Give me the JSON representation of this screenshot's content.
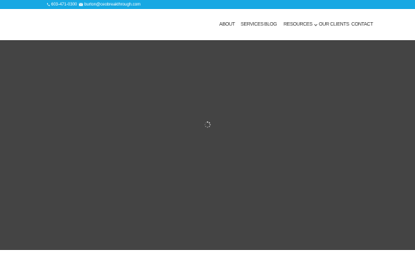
{
  "topbar": {
    "phone": "603-471-0300",
    "email": "burton@ceobreakthrough.com",
    "phone_icon": "phone-icon",
    "email_icon": "envelope-icon",
    "background_color": "#17a8e3"
  },
  "nav": {
    "items": [
      {
        "label": "ABOUT"
      },
      {
        "label": "SERVICES"
      },
      {
        "label": "BLOG"
      },
      {
        "label": "RESOURCES",
        "icon": "chevron-down-icon"
      },
      {
        "label": "OUR CLIENTS"
      },
      {
        "label": "CONTACT"
      }
    ]
  },
  "hero": {
    "background_color": "#444444",
    "loading_icon": "spinner-icon"
  }
}
